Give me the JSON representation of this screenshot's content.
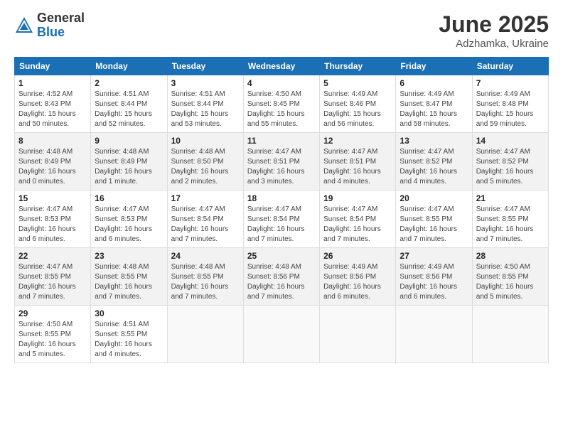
{
  "logo": {
    "general": "General",
    "blue": "Blue"
  },
  "title": {
    "month": "June 2025",
    "location": "Adzhamka, Ukraine"
  },
  "headers": [
    "Sunday",
    "Monday",
    "Tuesday",
    "Wednesday",
    "Thursday",
    "Friday",
    "Saturday"
  ],
  "weeks": [
    [
      {
        "day": "1",
        "info": "Sunrise: 4:52 AM\nSunset: 8:43 PM\nDaylight: 15 hours\nand 50 minutes."
      },
      {
        "day": "2",
        "info": "Sunrise: 4:51 AM\nSunset: 8:44 PM\nDaylight: 15 hours\nand 52 minutes."
      },
      {
        "day": "3",
        "info": "Sunrise: 4:51 AM\nSunset: 8:44 PM\nDaylight: 15 hours\nand 53 minutes."
      },
      {
        "day": "4",
        "info": "Sunrise: 4:50 AM\nSunset: 8:45 PM\nDaylight: 15 hours\nand 55 minutes."
      },
      {
        "day": "5",
        "info": "Sunrise: 4:49 AM\nSunset: 8:46 PM\nDaylight: 15 hours\nand 56 minutes."
      },
      {
        "day": "6",
        "info": "Sunrise: 4:49 AM\nSunset: 8:47 PM\nDaylight: 15 hours\nand 58 minutes."
      },
      {
        "day": "7",
        "info": "Sunrise: 4:49 AM\nSunset: 8:48 PM\nDaylight: 15 hours\nand 59 minutes."
      }
    ],
    [
      {
        "day": "8",
        "info": "Sunrise: 4:48 AM\nSunset: 8:49 PM\nDaylight: 16 hours\nand 0 minutes."
      },
      {
        "day": "9",
        "info": "Sunrise: 4:48 AM\nSunset: 8:49 PM\nDaylight: 16 hours\nand 1 minute."
      },
      {
        "day": "10",
        "info": "Sunrise: 4:48 AM\nSunset: 8:50 PM\nDaylight: 16 hours\nand 2 minutes."
      },
      {
        "day": "11",
        "info": "Sunrise: 4:47 AM\nSunset: 8:51 PM\nDaylight: 16 hours\nand 3 minutes."
      },
      {
        "day": "12",
        "info": "Sunrise: 4:47 AM\nSunset: 8:51 PM\nDaylight: 16 hours\nand 4 minutes."
      },
      {
        "day": "13",
        "info": "Sunrise: 4:47 AM\nSunset: 8:52 PM\nDaylight: 16 hours\nand 4 minutes."
      },
      {
        "day": "14",
        "info": "Sunrise: 4:47 AM\nSunset: 8:52 PM\nDaylight: 16 hours\nand 5 minutes."
      }
    ],
    [
      {
        "day": "15",
        "info": "Sunrise: 4:47 AM\nSunset: 8:53 PM\nDaylight: 16 hours\nand 6 minutes."
      },
      {
        "day": "16",
        "info": "Sunrise: 4:47 AM\nSunset: 8:53 PM\nDaylight: 16 hours\nand 6 minutes."
      },
      {
        "day": "17",
        "info": "Sunrise: 4:47 AM\nSunset: 8:54 PM\nDaylight: 16 hours\nand 7 minutes."
      },
      {
        "day": "18",
        "info": "Sunrise: 4:47 AM\nSunset: 8:54 PM\nDaylight: 16 hours\nand 7 minutes."
      },
      {
        "day": "19",
        "info": "Sunrise: 4:47 AM\nSunset: 8:54 PM\nDaylight: 16 hours\nand 7 minutes."
      },
      {
        "day": "20",
        "info": "Sunrise: 4:47 AM\nSunset: 8:55 PM\nDaylight: 16 hours\nand 7 minutes."
      },
      {
        "day": "21",
        "info": "Sunrise: 4:47 AM\nSunset: 8:55 PM\nDaylight: 16 hours\nand 7 minutes."
      }
    ],
    [
      {
        "day": "22",
        "info": "Sunrise: 4:47 AM\nSunset: 8:55 PM\nDaylight: 16 hours\nand 7 minutes."
      },
      {
        "day": "23",
        "info": "Sunrise: 4:48 AM\nSunset: 8:55 PM\nDaylight: 16 hours\nand 7 minutes."
      },
      {
        "day": "24",
        "info": "Sunrise: 4:48 AM\nSunset: 8:55 PM\nDaylight: 16 hours\nand 7 minutes."
      },
      {
        "day": "25",
        "info": "Sunrise: 4:48 AM\nSunset: 8:56 PM\nDaylight: 16 hours\nand 7 minutes."
      },
      {
        "day": "26",
        "info": "Sunrise: 4:49 AM\nSunset: 8:56 PM\nDaylight: 16 hours\nand 6 minutes."
      },
      {
        "day": "27",
        "info": "Sunrise: 4:49 AM\nSunset: 8:56 PM\nDaylight: 16 hours\nand 6 minutes."
      },
      {
        "day": "28",
        "info": "Sunrise: 4:50 AM\nSunset: 8:55 PM\nDaylight: 16 hours\nand 5 minutes."
      }
    ],
    [
      {
        "day": "29",
        "info": "Sunrise: 4:50 AM\nSunset: 8:55 PM\nDaylight: 16 hours\nand 5 minutes."
      },
      {
        "day": "30",
        "info": "Sunrise: 4:51 AM\nSunset: 8:55 PM\nDaylight: 16 hours\nand 4 minutes."
      },
      null,
      null,
      null,
      null,
      null
    ]
  ]
}
